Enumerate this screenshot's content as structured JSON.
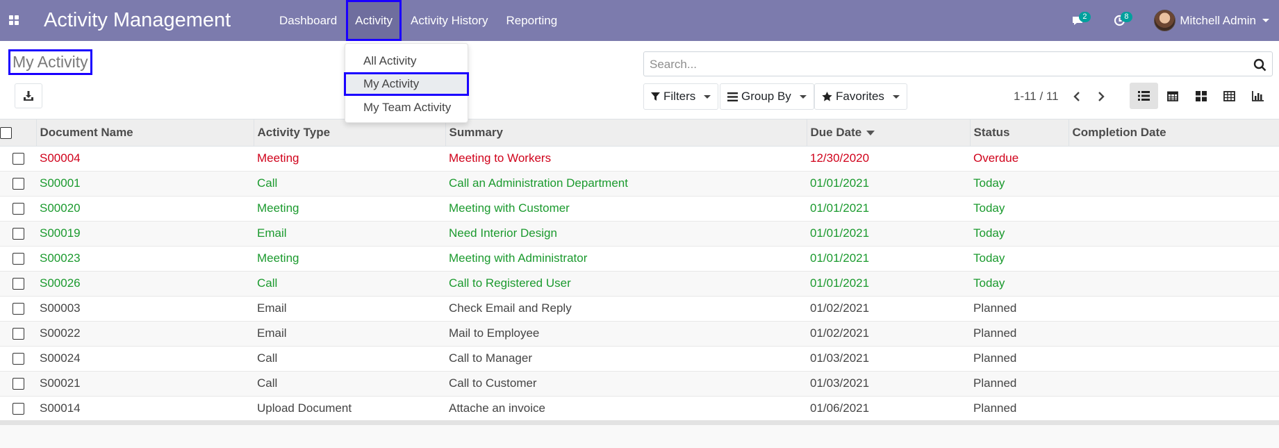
{
  "navbar": {
    "brand": "Activity Management",
    "menu": [
      {
        "label": "Dashboard"
      },
      {
        "label": "Activity"
      },
      {
        "label": "Activity History"
      },
      {
        "label": "Reporting"
      }
    ],
    "messages_count": "2",
    "activities_count": "8",
    "user_name": "Mitchell Admin"
  },
  "activity_menu": {
    "items": [
      {
        "label": "All Activity"
      },
      {
        "label": "My Activity"
      },
      {
        "label": "My Team Activity"
      }
    ]
  },
  "control_panel": {
    "title": "My Activity",
    "search_placeholder": "Search...",
    "filters_label": "Filters",
    "group_by_label": "Group By",
    "favorites_label": "Favorites",
    "pager": "1-11 / 11"
  },
  "table": {
    "columns": [
      "Document Name",
      "Activity Type",
      "Summary",
      "Due Date",
      "Status",
      "Completion Date"
    ],
    "rows": [
      {
        "document": "S00004",
        "type": "Meeting",
        "summary": "Meeting to Workers",
        "due": "12/30/2020",
        "status": "Overdue",
        "completion": ""
      },
      {
        "document": "S00001",
        "type": "Call",
        "summary": "Call an Administration Department",
        "due": "01/01/2021",
        "status": "Today",
        "completion": ""
      },
      {
        "document": "S00020",
        "type": "Meeting",
        "summary": "Meeting with Customer",
        "due": "01/01/2021",
        "status": "Today",
        "completion": ""
      },
      {
        "document": "S00019",
        "type": "Email",
        "summary": "Need Interior Design",
        "due": "01/01/2021",
        "status": "Today",
        "completion": ""
      },
      {
        "document": "S00023",
        "type": "Meeting",
        "summary": "Meeting with Administrator",
        "due": "01/01/2021",
        "status": "Today",
        "completion": ""
      },
      {
        "document": "S00026",
        "type": "Call",
        "summary": "Call to Registered User",
        "due": "01/01/2021",
        "status": "Today",
        "completion": ""
      },
      {
        "document": "S00003",
        "type": "Email",
        "summary": "Check Email and Reply",
        "due": "01/02/2021",
        "status": "Planned",
        "completion": ""
      },
      {
        "document": "S00022",
        "type": "Email",
        "summary": "Mail to Employee",
        "due": "01/02/2021",
        "status": "Planned",
        "completion": ""
      },
      {
        "document": "S00024",
        "type": "Call",
        "summary": "Call to Manager",
        "due": "01/03/2021",
        "status": "Planned",
        "completion": ""
      },
      {
        "document": "S00021",
        "type": "Call",
        "summary": "Call to Customer",
        "due": "01/03/2021",
        "status": "Planned",
        "completion": ""
      },
      {
        "document": "S00014",
        "type": "Upload Document",
        "summary": "Attache an invoice",
        "due": "01/06/2021",
        "status": "Planned",
        "completion": ""
      }
    ]
  },
  "colors": {
    "navbar": "#7c7bad",
    "overdue": "#d0021b",
    "today": "#1b9a2e",
    "badge": "#00a09d",
    "highlight_box": "#1a00ff"
  }
}
